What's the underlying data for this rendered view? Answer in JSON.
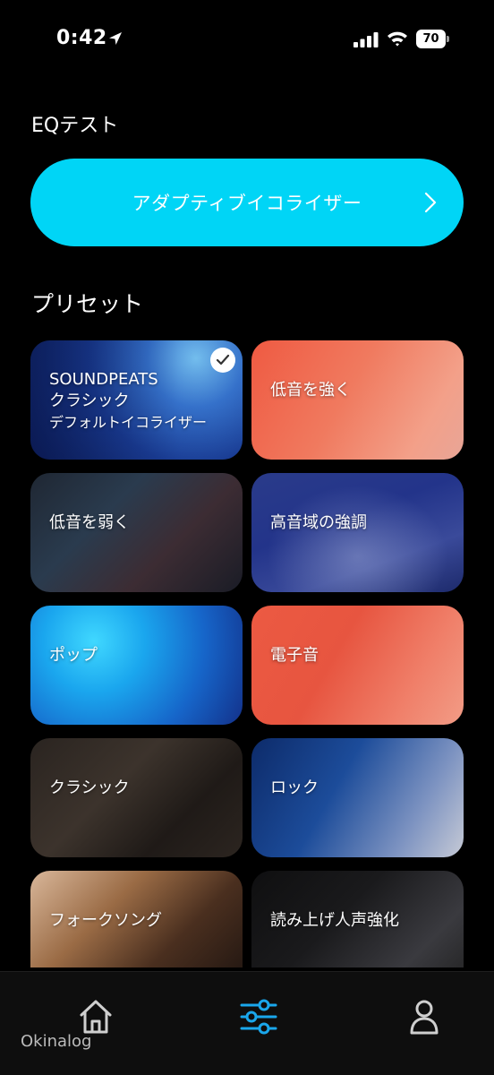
{
  "status_bar": {
    "time": "0:42",
    "battery": "70"
  },
  "eq": {
    "title": "EQテスト",
    "adaptive_button_label": "アダプティブイコライザー"
  },
  "presets": {
    "title": "プリセット",
    "items": [
      {
        "label_lines": [
          "SOUNDPEATS",
          "クラシック",
          "デフォルトイコライザー"
        ],
        "selected": true
      },
      {
        "label_lines": [
          "低音を強く"
        ],
        "selected": false
      },
      {
        "label_lines": [
          "低音を弱く"
        ],
        "selected": false
      },
      {
        "label_lines": [
          "高音域の強調"
        ],
        "selected": false
      },
      {
        "label_lines": [
          "ポップ"
        ],
        "selected": false
      },
      {
        "label_lines": [
          "電子音"
        ],
        "selected": false
      },
      {
        "label_lines": [
          "クラシック"
        ],
        "selected": false
      },
      {
        "label_lines": [
          "ロック"
        ],
        "selected": false
      },
      {
        "label_lines": [
          "フォークソング"
        ],
        "selected": false
      },
      {
        "label_lines": [
          "読み上げ人声強化"
        ],
        "selected": false
      }
    ]
  },
  "nav": {
    "items": [
      "home-icon",
      "equalizer-icon",
      "profile-icon"
    ],
    "active_index": 1,
    "active_color": "#1aa7ec"
  },
  "watermark": "Okinalog",
  "colors": {
    "accent": "#00d5f6",
    "background": "#000000"
  }
}
